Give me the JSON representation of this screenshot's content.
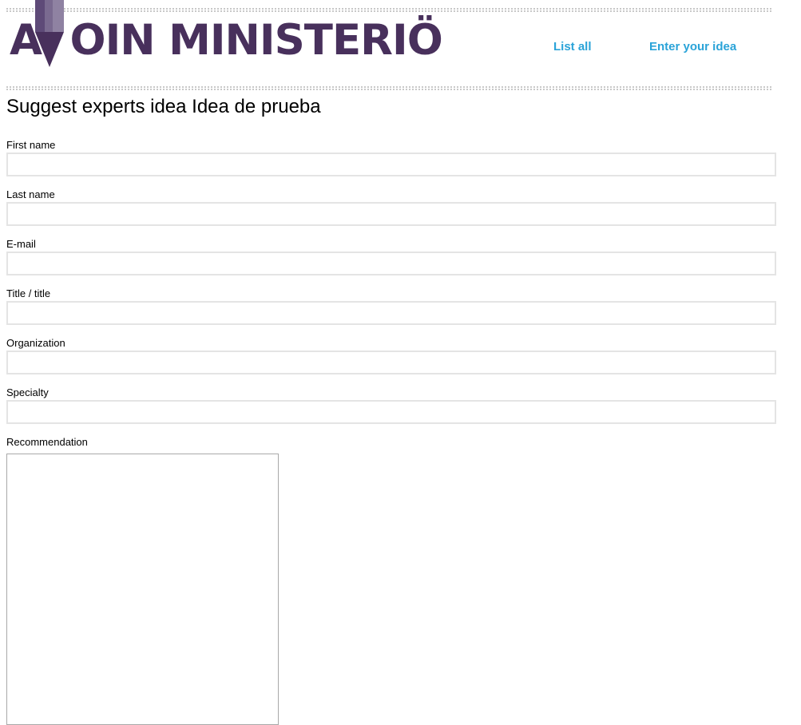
{
  "header": {
    "logo_text": "AVOIN MINISTERIÖ",
    "logo_text_before": "A",
    "logo_hidden_letter": "V",
    "logo_text_after": "OIN MINISTERIÖ",
    "brand_colors": {
      "logo": "#48305c",
      "pencil_light": "#7a6a90",
      "pencil_mid": "#5e4a78",
      "link": "#2aa3d8"
    },
    "nav": {
      "list_all": "List all",
      "enter_idea": "Enter your idea"
    }
  },
  "page": {
    "title": "Suggest experts idea Idea de prueba"
  },
  "form": {
    "fields": [
      {
        "label": "First name",
        "value": ""
      },
      {
        "label": "Last name",
        "value": ""
      },
      {
        "label": "E-mail",
        "value": ""
      },
      {
        "label": "Title / title",
        "value": ""
      },
      {
        "label": "Organization",
        "value": ""
      },
      {
        "label": "Specialty",
        "value": ""
      }
    ],
    "recommendation": {
      "label": "Recommendation",
      "value": ""
    }
  }
}
